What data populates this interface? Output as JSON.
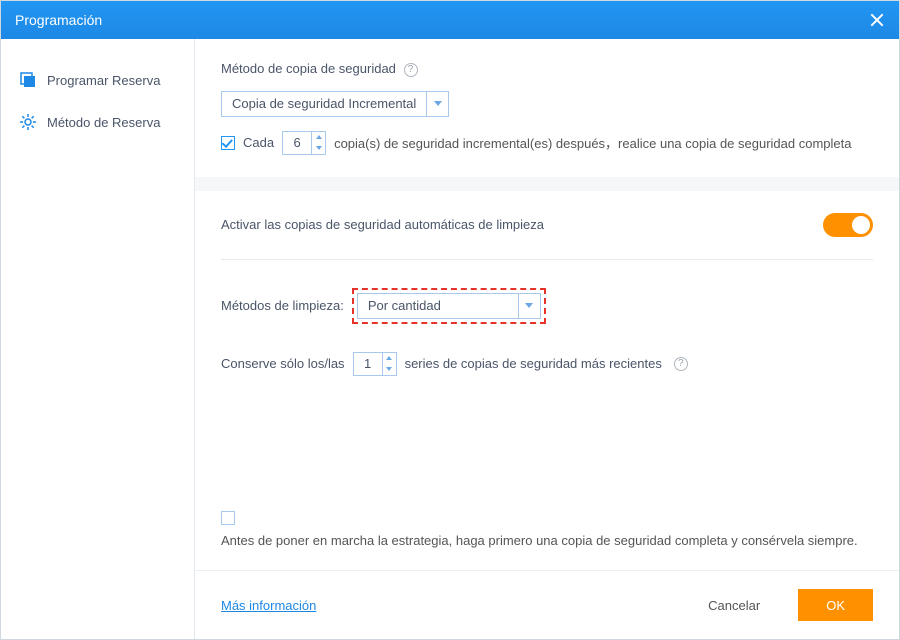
{
  "titlebar": {
    "title": "Programación"
  },
  "sidebar": {
    "items": [
      {
        "label": "Programar Reserva"
      },
      {
        "label": "Método de Reserva"
      }
    ]
  },
  "panel1": {
    "method_label": "Método de copia de seguridad",
    "method_value": "Copia de seguridad Incremental",
    "cada_label": "Cada",
    "cada_value": "6",
    "cada_suffix": "copia(s) de seguridad incremental(es) después，realice una copia de seguridad completa"
  },
  "panel2": {
    "auto_clean_label": "Activar las copias de seguridad automáticas de limpieza",
    "clean_method_label": "Métodos de limpieza:",
    "clean_method_value": "Por cantidad",
    "keep_prefix": "Conserve sólo los/las",
    "keep_value": "1",
    "keep_suffix": "series de copias de seguridad más recientes",
    "strategy_note": "Antes de poner en marcha la estrategia, haga primero una copia de seguridad completa y consérvela siempre."
  },
  "footer": {
    "more_info": "Más información",
    "cancel": "Cancelar",
    "ok": "OK"
  }
}
